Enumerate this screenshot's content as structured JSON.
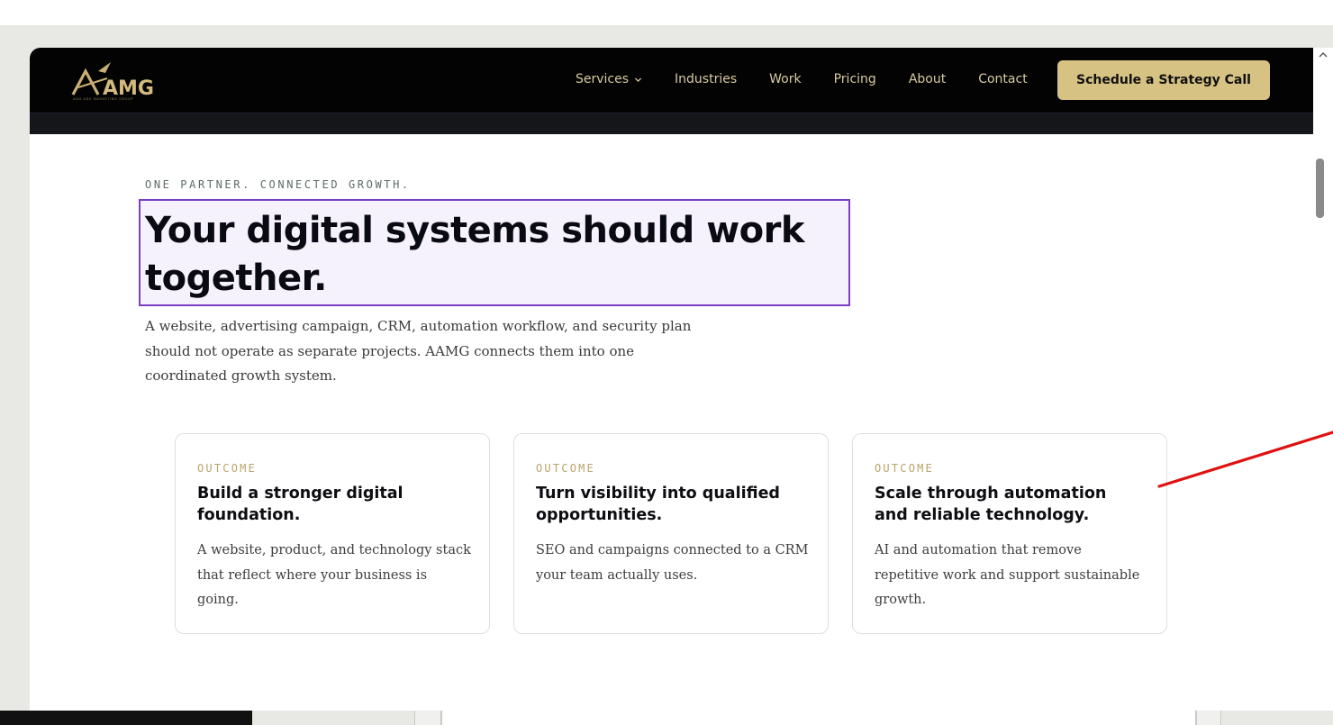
{
  "brand": {
    "logo_text": "AMG",
    "logo_tagline": "ADD ADS MARKETING GROUP",
    "accent_color": "#d6c282",
    "nav_bg": "#030303"
  },
  "nav": {
    "items": [
      {
        "label": "Services",
        "has_dropdown": true
      },
      {
        "label": "Industries"
      },
      {
        "label": "Work"
      },
      {
        "label": "Pricing"
      },
      {
        "label": "About"
      },
      {
        "label": "Contact"
      }
    ],
    "cta_label": "Schedule a Strategy Call"
  },
  "hero": {
    "eyebrow": "ONE PARTNER. CONNECTED GROWTH.",
    "headline": "Your digital systems should work together.",
    "lead": "A website, advertising campaign, CRM, automation workflow, and security plan should not operate as separate projects. AAMG connects them into one coordinated growth system.",
    "highlight_color": "#7b3fc4"
  },
  "cards": [
    {
      "kicker": "OUTCOME",
      "title": "Build a stronger digital foundation.",
      "body": "A website, product, and technology stack that reflect where your business is going."
    },
    {
      "kicker": "OUTCOME",
      "title": "Turn visibility into qualified opportunities.",
      "body": "SEO and campaigns connected to a CRM your team actually uses."
    },
    {
      "kicker": "OUTCOME",
      "title": "Scale through automation and reliable technology.",
      "body": "AI and automation that remove repetitive work and support sustainable growth."
    }
  ],
  "annotation": {
    "color": "#e01010"
  }
}
